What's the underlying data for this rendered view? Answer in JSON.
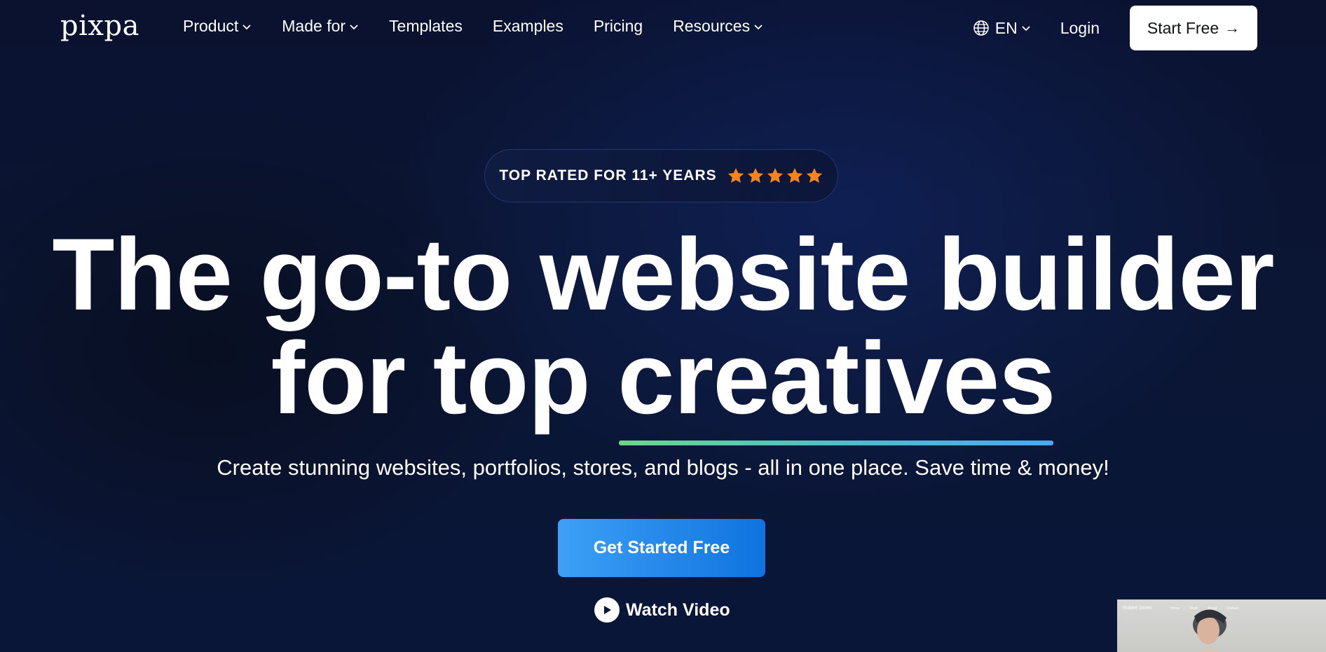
{
  "brand": {
    "logo_text": "pixpa"
  },
  "nav": {
    "items": [
      {
        "label": "Product",
        "has_dropdown": true
      },
      {
        "label": "Made for",
        "has_dropdown": true
      },
      {
        "label": "Templates",
        "has_dropdown": false
      },
      {
        "label": "Examples",
        "has_dropdown": false
      },
      {
        "label": "Pricing",
        "has_dropdown": false
      },
      {
        "label": "Resources",
        "has_dropdown": true
      }
    ],
    "language": "EN",
    "login_label": "Login",
    "start_label": "Start Free",
    "start_arrow": "→"
  },
  "badge": {
    "text": "TOP RATED FOR 11+ YEARS",
    "rating": 5,
    "star_color": "#f5841f"
  },
  "hero": {
    "headline_line1": "The go-to website builder",
    "headline_line2_prefix": "for top ",
    "headline_highlight": "creatives",
    "subtitle": "Create stunning websites, portfolios, stores, and blogs - all in one place. Save time & money!",
    "cta_label": "Get Started Free",
    "watch_label": "Watch Video"
  },
  "preview": {
    "site_name": "Robert Jones",
    "menu": [
      "Home",
      "Work",
      "About",
      "Contact"
    ]
  },
  "colors": {
    "cta_start": "#3da0f5",
    "cta_end": "#0f73e0",
    "underline_start": "#6fd58a",
    "underline_end": "#4aa8f2"
  }
}
